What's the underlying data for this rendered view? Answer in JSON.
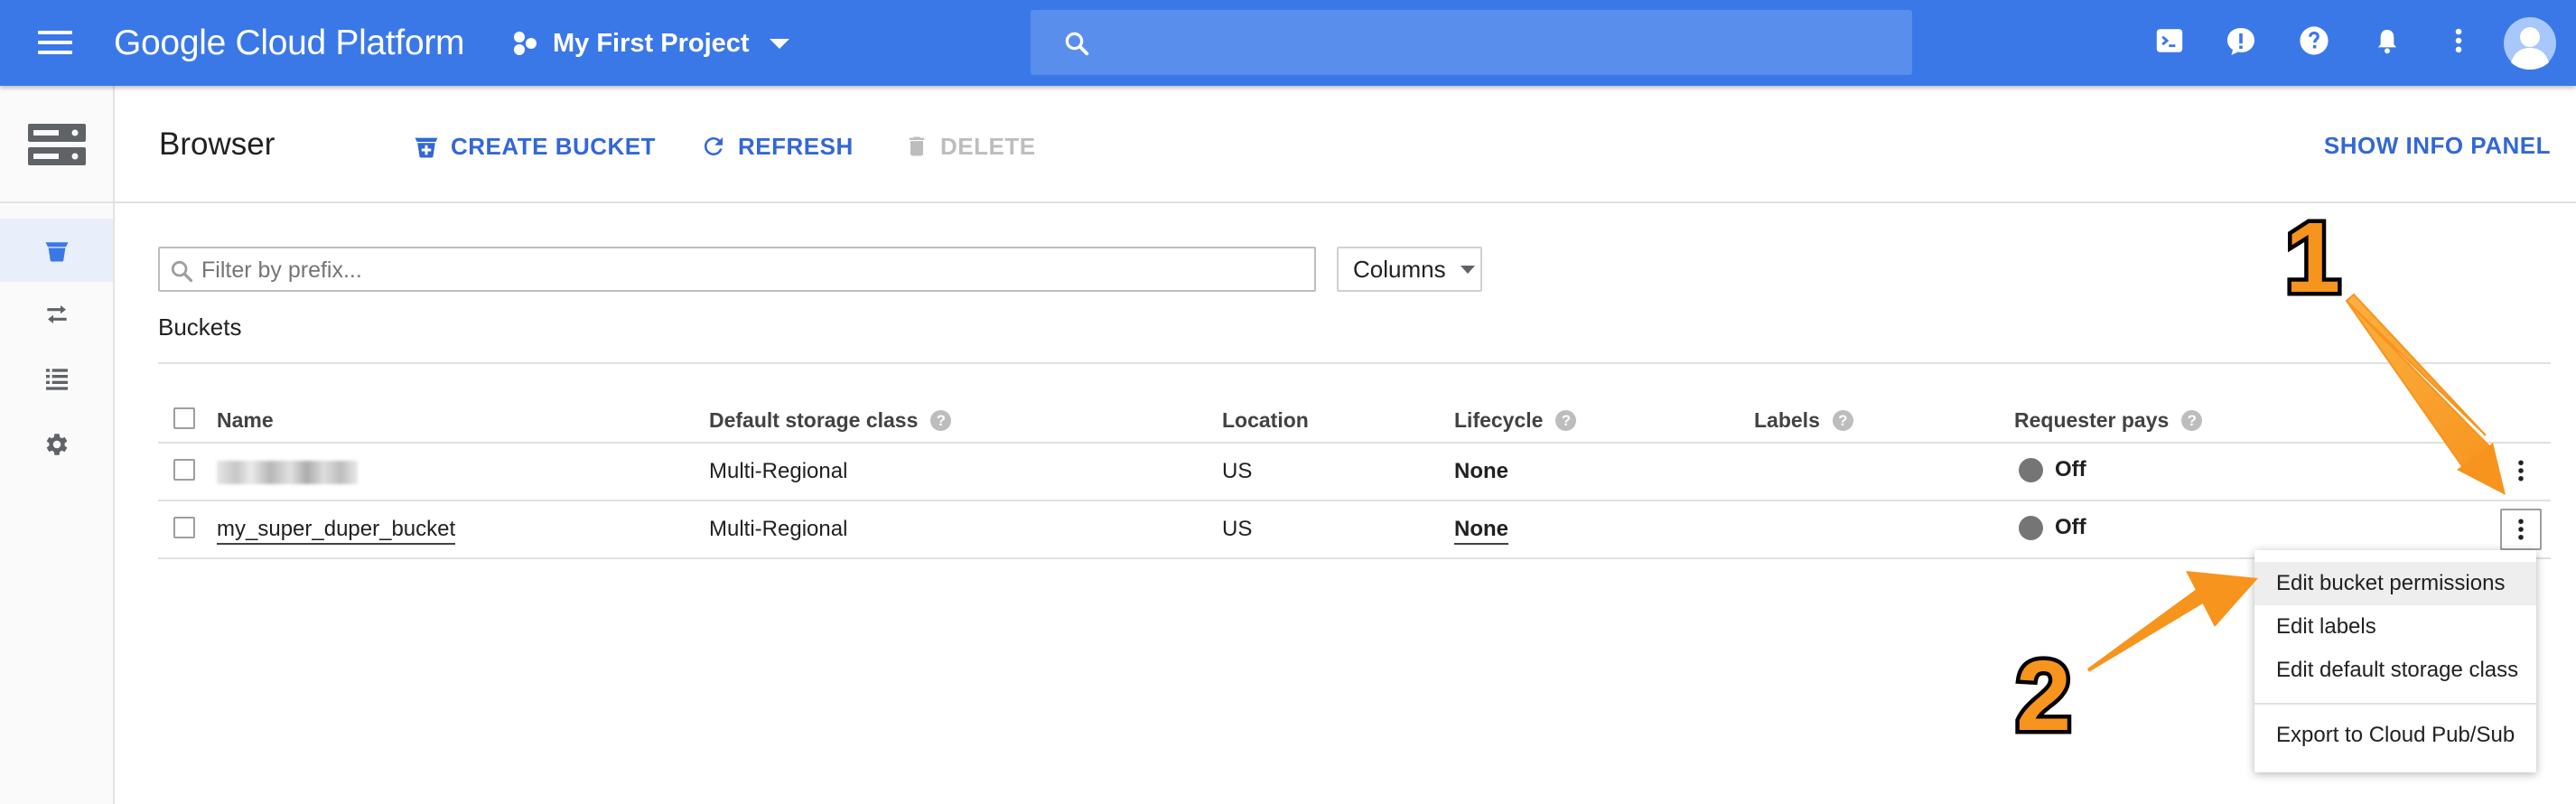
{
  "header": {
    "brand": "Google Cloud Platform",
    "project": "My First Project",
    "search_placeholder": ""
  },
  "icons": [
    "menu-icon",
    "project-icon",
    "dropdown-caret-icon",
    "search-icon",
    "cloud-shell-icon",
    "feedback-icon",
    "help-icon",
    "notifications-icon",
    "more-vert-icon",
    "account-avatar-icon",
    "storage-product-icon",
    "bucket-icon",
    "transfer-icon",
    "list-icon",
    "settings-icon",
    "create-bucket-icon",
    "refresh-icon",
    "delete-icon",
    "filter-search-icon"
  ],
  "toolbar": {
    "title": "Browser",
    "create_bucket": "CREATE BUCKET",
    "refresh": "REFRESH",
    "delete": "DELETE",
    "show_info_panel": "SHOW INFO PANEL"
  },
  "filter": {
    "placeholder": "Filter by prefix...",
    "columns_label": "Columns"
  },
  "section_title": "Buckets",
  "table": {
    "columns": [
      "Name",
      "Default storage class",
      "Location",
      "Lifecycle",
      "Labels",
      "Requester pays"
    ],
    "rows": [
      {
        "name": "",
        "storage_class": "Multi-Regional",
        "location": "US",
        "lifecycle": "None",
        "labels": "",
        "requester_pays": "Off"
      },
      {
        "name": "my_super_duper_bucket",
        "storage_class": "Multi-Regional",
        "location": "US",
        "lifecycle": "None",
        "labels": "",
        "requester_pays": "Off"
      }
    ]
  },
  "context_menu": {
    "items": [
      "Edit bucket permissions",
      "Edit labels",
      "Edit default storage class",
      "Export to Cloud Pub/Sub"
    ],
    "highlighted": "Edit bucket permissions"
  },
  "annotations": {
    "step1": "1",
    "step2": "2",
    "arrow_color": "#f7941d"
  },
  "colors": {
    "header_bg": "#3b78e7",
    "accent": "#3367d6",
    "disabled": "#bdbdbd"
  }
}
